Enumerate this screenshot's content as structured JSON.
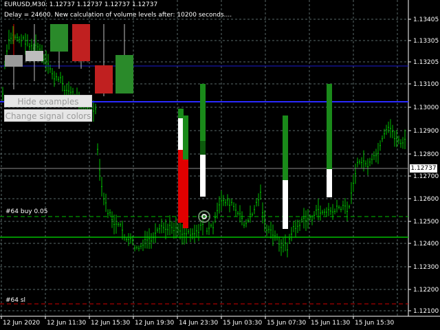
{
  "header": {
    "title": "EURUSD,M30:  1.12737  1.12737  1.12737  1.12737",
    "info": "Delay = 24600. New calculation of volume levels after: 10200 seconds...."
  },
  "buttons": {
    "hide_examples": "Hide examples",
    "change_colors": "Change signal colors"
  },
  "orders": {
    "buy_label": "#64 buy 0.05",
    "sl_label": "#64 sl"
  },
  "price_axis": {
    "current": "1.12737",
    "labels": [
      "1.13405",
      "1.13305",
      "1.13205",
      "1.13100",
      "1.13000",
      "1.12900",
      "1.12800",
      "1.12700",
      "1.12600",
      "1.12500",
      "1.12400",
      "1.12300",
      "1.12200",
      "1.12100"
    ]
  },
  "time_axis": {
    "labels": [
      "12 Jun 2020",
      "12 Jun 11:30",
      "12 Jun 15:30",
      "12 Jun 19:30",
      "14 Jun 23:30",
      "15 Jun 03:30",
      "15 Jun 07:30",
      "15 Jun 11:30",
      "15 Jun 15:30"
    ]
  },
  "colors": {
    "background": "#000000",
    "candle_up": "#00c000",
    "grid": "#5a6a6a",
    "level_blue": "#1a1ad0",
    "order_green": "#00c000",
    "sl_red": "#d00000",
    "signal_red": "#e00000",
    "signal_green": "#1a8a1a",
    "signal_white": "#ffffff"
  },
  "icons": {
    "trade_marker": "trade-circle-icon"
  }
}
